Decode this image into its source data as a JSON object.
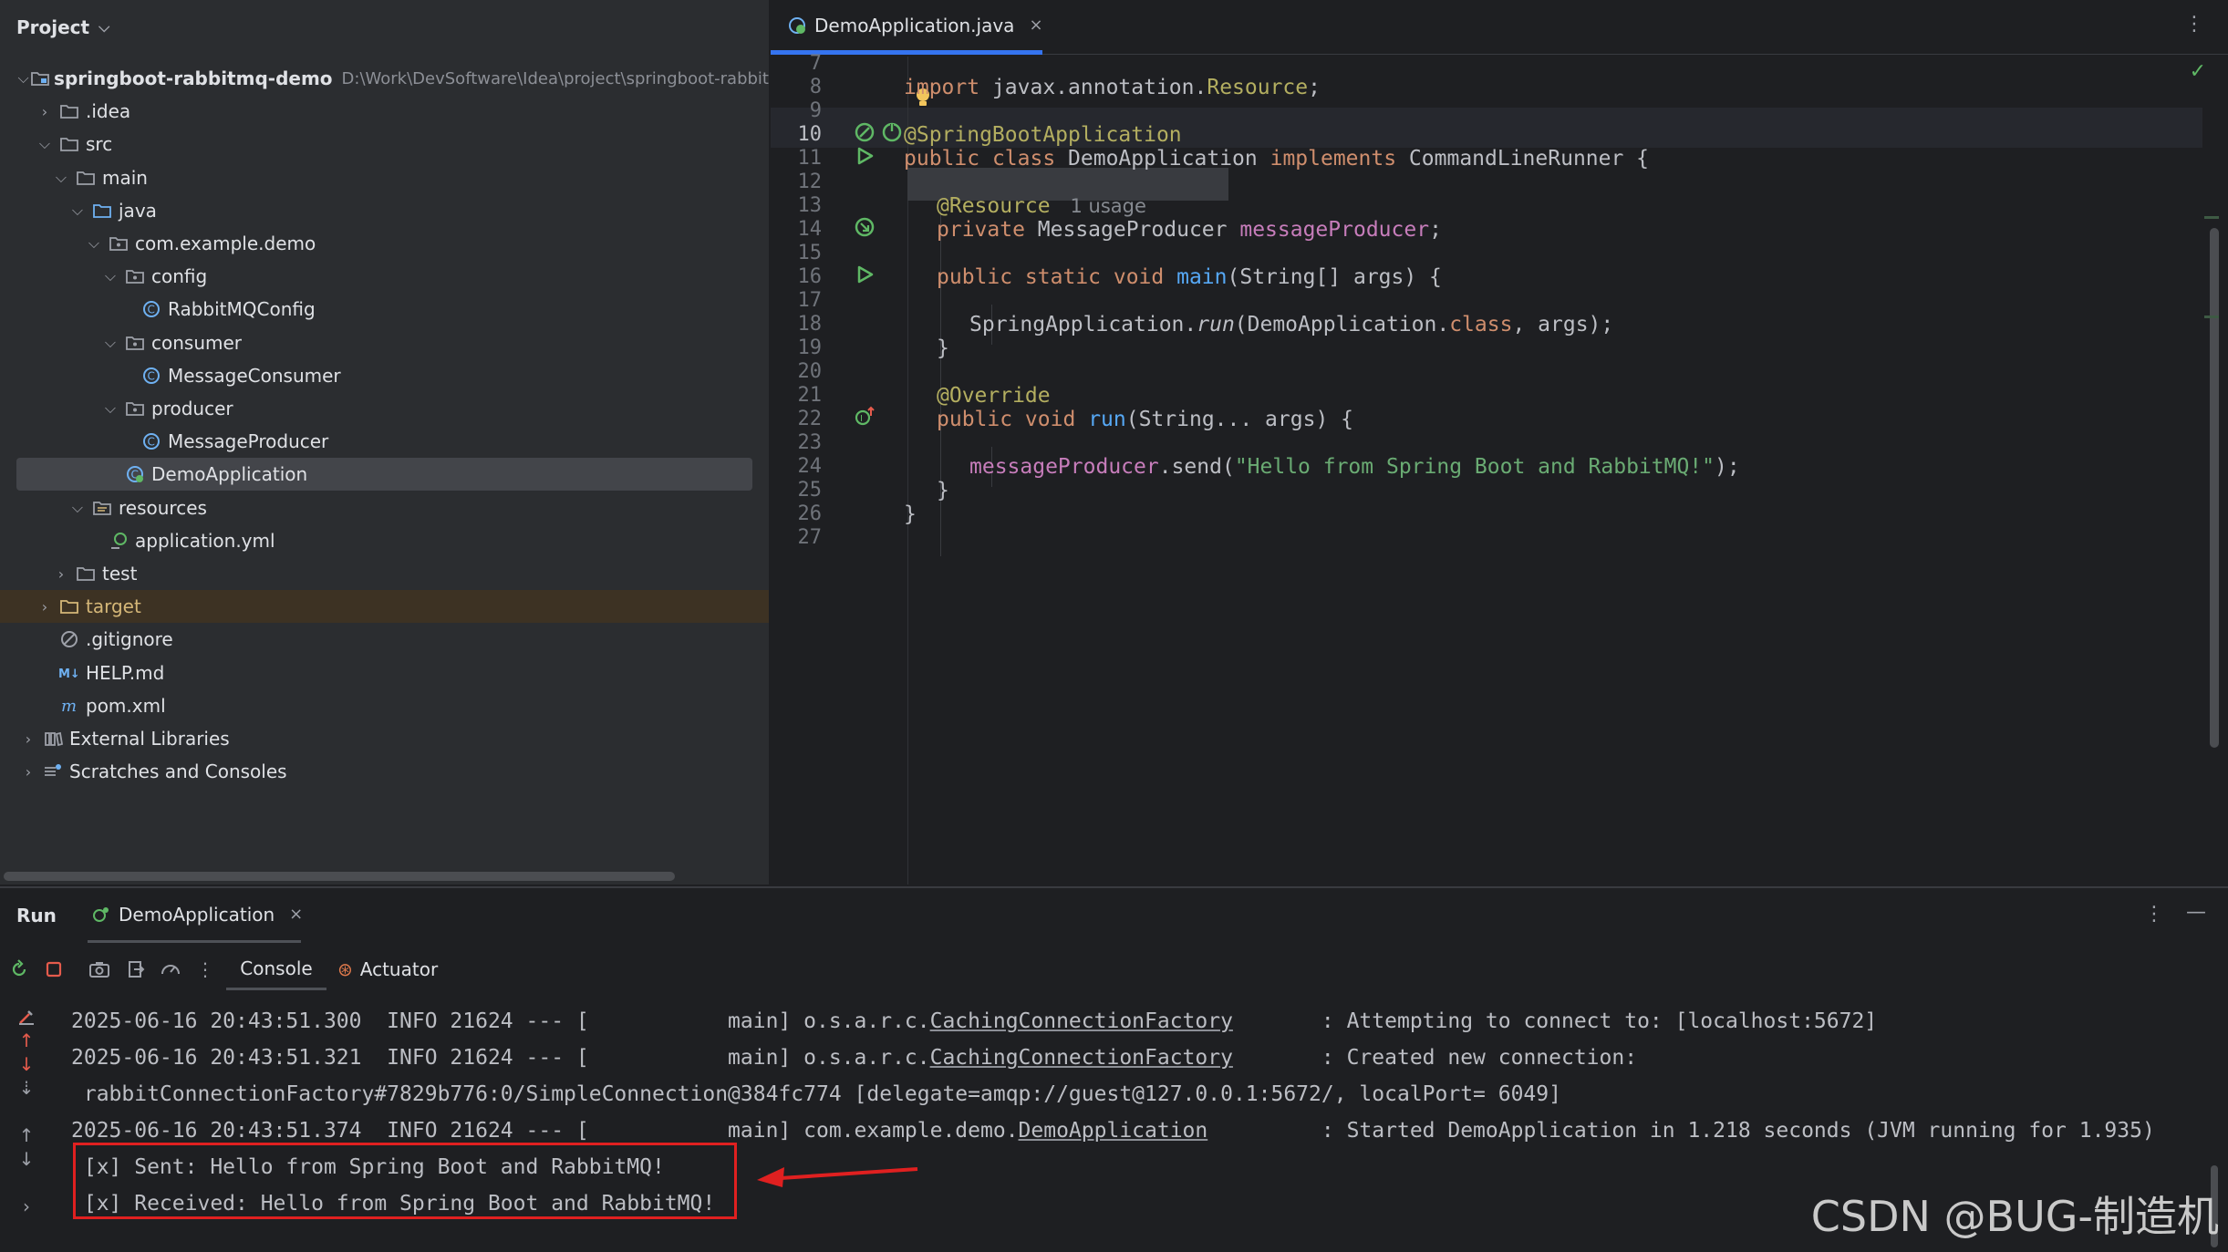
{
  "project": {
    "title": "Project",
    "tree": [
      {
        "label": "springboot-rabbitmq-demo",
        "path": "D:\\Work\\DevSoftware\\Idea\\project\\springboot-rabbit",
        "icon": "module-folder-icon",
        "arrow": "down",
        "indent": 0,
        "bold": true
      },
      {
        "label": ".idea",
        "icon": "folder-icon",
        "arrow": "right",
        "indent": 1
      },
      {
        "label": "src",
        "icon": "folder-icon",
        "arrow": "down",
        "indent": 1
      },
      {
        "label": "main",
        "icon": "folder-icon",
        "arrow": "down",
        "indent": 2
      },
      {
        "label": "java",
        "icon": "source-folder-icon",
        "arrow": "down",
        "indent": 3
      },
      {
        "label": "com.example.demo",
        "icon": "package-icon",
        "arrow": "down",
        "indent": 4
      },
      {
        "label": "config",
        "icon": "package-icon",
        "arrow": "down",
        "indent": 5
      },
      {
        "label": "RabbitMQConfig",
        "icon": "class-icon",
        "arrow": "none",
        "indent": 6
      },
      {
        "label": "consumer",
        "icon": "package-icon",
        "arrow": "down",
        "indent": 5
      },
      {
        "label": "MessageConsumer",
        "icon": "class-icon",
        "arrow": "none",
        "indent": 6
      },
      {
        "label": "producer",
        "icon": "package-icon",
        "arrow": "down",
        "indent": 5
      },
      {
        "label": "MessageProducer",
        "icon": "class-icon",
        "arrow": "none",
        "indent": 6
      },
      {
        "label": "DemoApplication",
        "icon": "spring-class-icon",
        "arrow": "none",
        "indent": 5,
        "selected": true
      },
      {
        "label": "resources",
        "icon": "resources-folder-icon",
        "arrow": "down",
        "indent": 3
      },
      {
        "label": "application.yml",
        "icon": "yaml-icon",
        "arrow": "none",
        "indent": 4
      },
      {
        "label": "test",
        "icon": "folder-icon",
        "arrow": "right",
        "indent": 2
      },
      {
        "label": "target",
        "icon": "excluded-folder-icon",
        "arrow": "right",
        "indent": 1,
        "excluded": true
      },
      {
        "label": ".gitignore",
        "icon": "ignore-icon",
        "arrow": "none",
        "indent": 1
      },
      {
        "label": "HELP.md",
        "icon": "markdown-icon",
        "arrow": "none",
        "indent": 1
      },
      {
        "label": "pom.xml",
        "icon": "maven-icon",
        "arrow": "none",
        "indent": 1
      },
      {
        "label": "External Libraries",
        "icon": "libraries-icon",
        "arrow": "right",
        "indent": 0
      },
      {
        "label": "Scratches and Consoles",
        "icon": "scratches-icon",
        "arrow": "right",
        "indent": 0
      }
    ]
  },
  "editor": {
    "tab_label": "DemoApplication.java",
    "tab_close": "×",
    "line_numbers": [
      "7",
      "8",
      "9",
      "10",
      "11",
      "12",
      "13",
      "14",
      "15",
      "16",
      "17",
      "18",
      "19",
      "20",
      "21",
      "22",
      "23",
      "24",
      "25",
      "26",
      "27"
    ],
    "current_line": "10",
    "code": {
      "l8_import": "import",
      "l8_pkg_a": " javax.annotation.",
      "l8_pkg_b": "Resource",
      "l8_semicolon": ";",
      "l10_annotation": "@SpringBootApplication",
      "l11_public": "public",
      "l11_class": " class",
      "l11_name": " DemoApplication ",
      "l11_implements": "implements",
      "l11_rest": " CommandLineRunner {",
      "l13_annotation": "@Resource",
      "l13_hint": "1 usage",
      "l14_private": "private",
      "l14_type": " MessageProducer ",
      "l14_field": "messageProducer",
      "l14_semicolon": ";",
      "l16_mods": "public static void",
      "l16_main": "main",
      "l16_rest": "(String[] args) {",
      "l18_a": "SpringApplication.",
      "l18_run": "run",
      "l18_b": "(DemoApplication.",
      "l18_class": "class",
      "l18_c": ", args);",
      "l19_brace": "}",
      "l21_override": "@Override",
      "l22_mods": "public void",
      "l22_run": "run",
      "l22_rest": "(String... args) {",
      "l24_field": "messageProducer",
      "l24_send": ".send(",
      "l24_string": "\"Hello from Spring Boot and RabbitMQ!\"",
      "l24_end": ");",
      "l25_brace": "}",
      "l26_brace": "}"
    }
  },
  "run": {
    "title": "Run",
    "tab_label": "DemoApplication",
    "tab_close": "×",
    "console_tab": "Console",
    "actuator_tab": "Actuator",
    "log": {
      "l1_a": "2025-06-16 20:43:51.300  INFO 21624 --- [           main] o.s.a.r.c.",
      "l1_logger": "CachingConnectionFactory",
      "l1_b": "       : Attempting to connect to: [localhost:5672]",
      "l2_a": "2025-06-16 20:43:51.321  INFO 21624 --- [           main] o.s.a.r.c.",
      "l2_logger": "CachingConnectionFactory",
      "l2_b": "       : Created new connection:",
      "l3": " rabbitConnectionFactory#7829b776:0/SimpleConnection@384fc774 [delegate=amqp://guest@127.0.0.1:5672/, localPort= 6049]",
      "l4_a": "2025-06-16 20:43:51.374  INFO 21624 --- [           main] com.example.demo.",
      "l4_logger": "DemoApplication",
      "l4_b": "         : Started DemoApplication in 1.218 seconds (JVM running for 1.935)",
      "l5": " [x] Sent: Hello from Spring Boot and RabbitMQ!",
      "l6": " [x] Received: Hello from Spring Boot and RabbitMQ!"
    }
  },
  "watermark": "CSDN @BUG-制造机",
  "colors": {
    "accent": "#3574f0",
    "keyword": "#cf8e6d",
    "annotation": "#b3ae60",
    "function": "#56a8f5",
    "field": "#c77dbb",
    "string": "#6aab73",
    "highlight_box": "#e02020"
  }
}
